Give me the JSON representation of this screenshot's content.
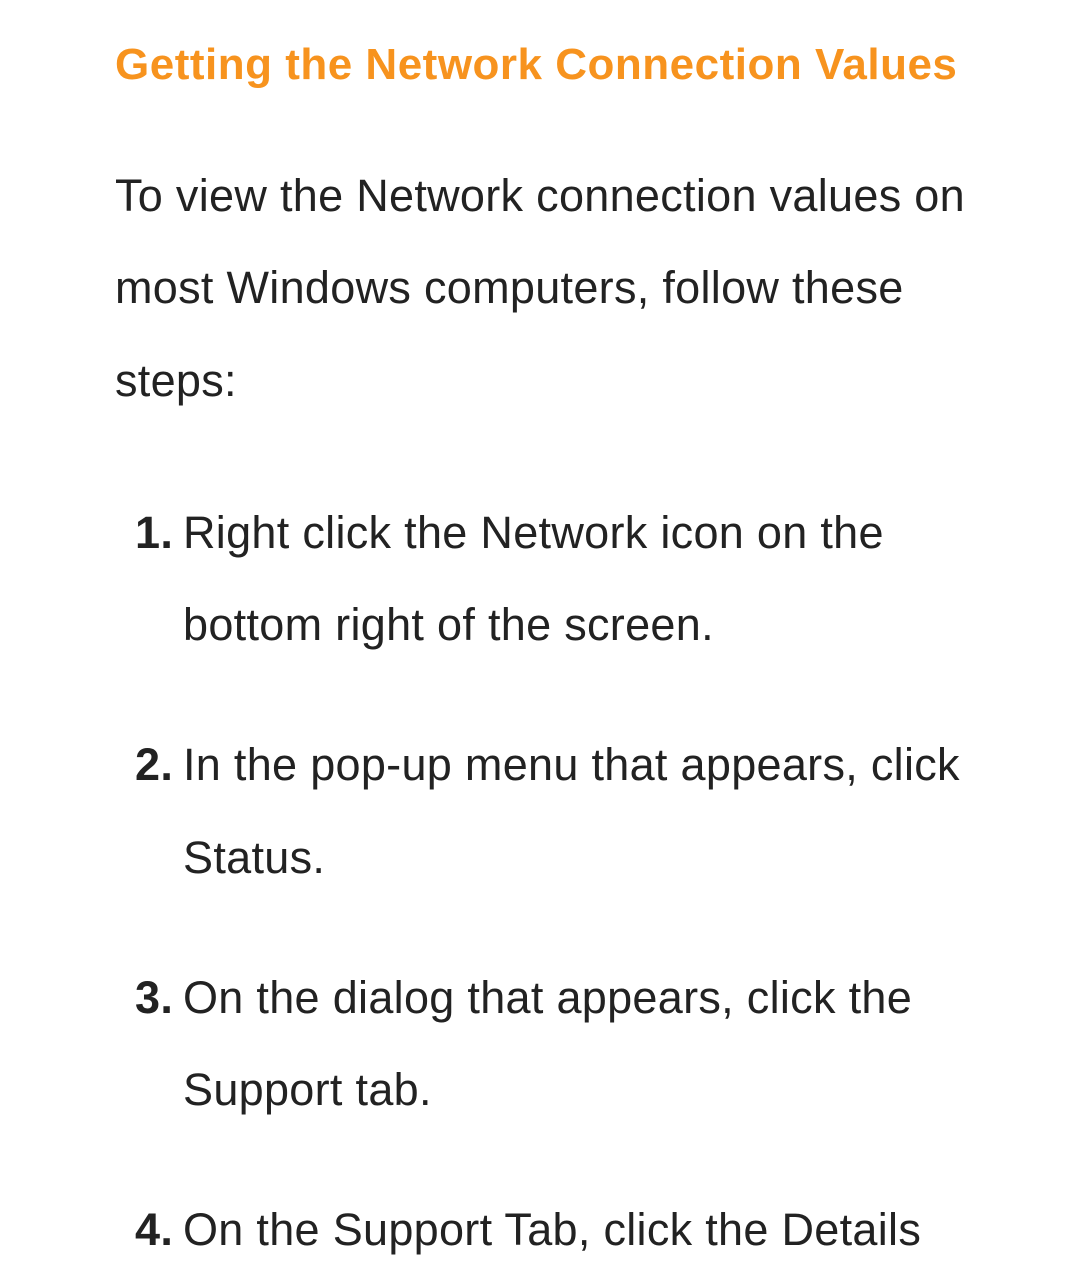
{
  "heading": "Getting the Network Connection Values",
  "intro": "To view the Network connection values on most Windows computers, follow these steps:",
  "steps": [
    {
      "num": "1.",
      "text": "Right click the Network icon on the bottom right of the screen."
    },
    {
      "num": "2.",
      "text": "In the pop-up menu that appears, click Status."
    },
    {
      "num": "3.",
      "text": "On the dialog that appears, click the Support tab."
    },
    {
      "num": "4.",
      "text": "On the Support Tab, click the Details"
    }
  ]
}
